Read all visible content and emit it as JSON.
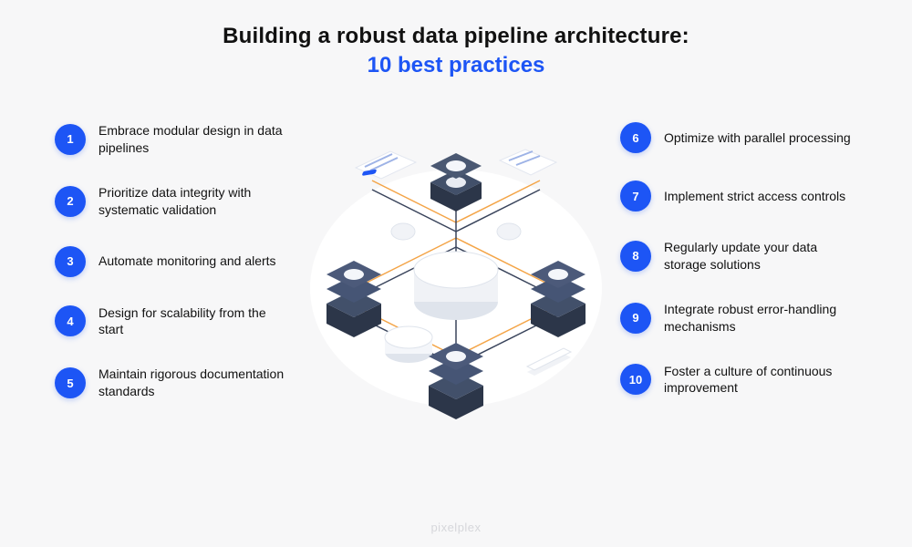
{
  "header": {
    "title_main": "Building a robust data pipeline architecture:",
    "title_sub": "10 best practices"
  },
  "left_items": [
    {
      "n": "1",
      "text": "Embrace modular design in data pipelines"
    },
    {
      "n": "2",
      "text": "Prioritize data integrity with systematic validation"
    },
    {
      "n": "3",
      "text": "Automate monitoring and alerts"
    },
    {
      "n": "4",
      "text": "Design for scalability from the start"
    },
    {
      "n": "5",
      "text": "Maintain rigorous documentation standards"
    }
  ],
  "right_items": [
    {
      "n": "6",
      "text": "Optimize with parallel processing"
    },
    {
      "n": "7",
      "text": "Implement strict access controls"
    },
    {
      "n": "8",
      "text": "Regularly update your data storage solutions"
    },
    {
      "n": "9",
      "text": "Integrate robust error-handling mechanisms"
    },
    {
      "n": "10",
      "text": "Foster a culture of continuous improvement"
    }
  ],
  "watermark": "pixelplex",
  "colors": {
    "accent": "#1d55f5",
    "stack_dark": "#3a455c",
    "stack_light": "#eef1f6",
    "node_fill": "#f3f5f8",
    "orange_line": "#f4a548"
  }
}
